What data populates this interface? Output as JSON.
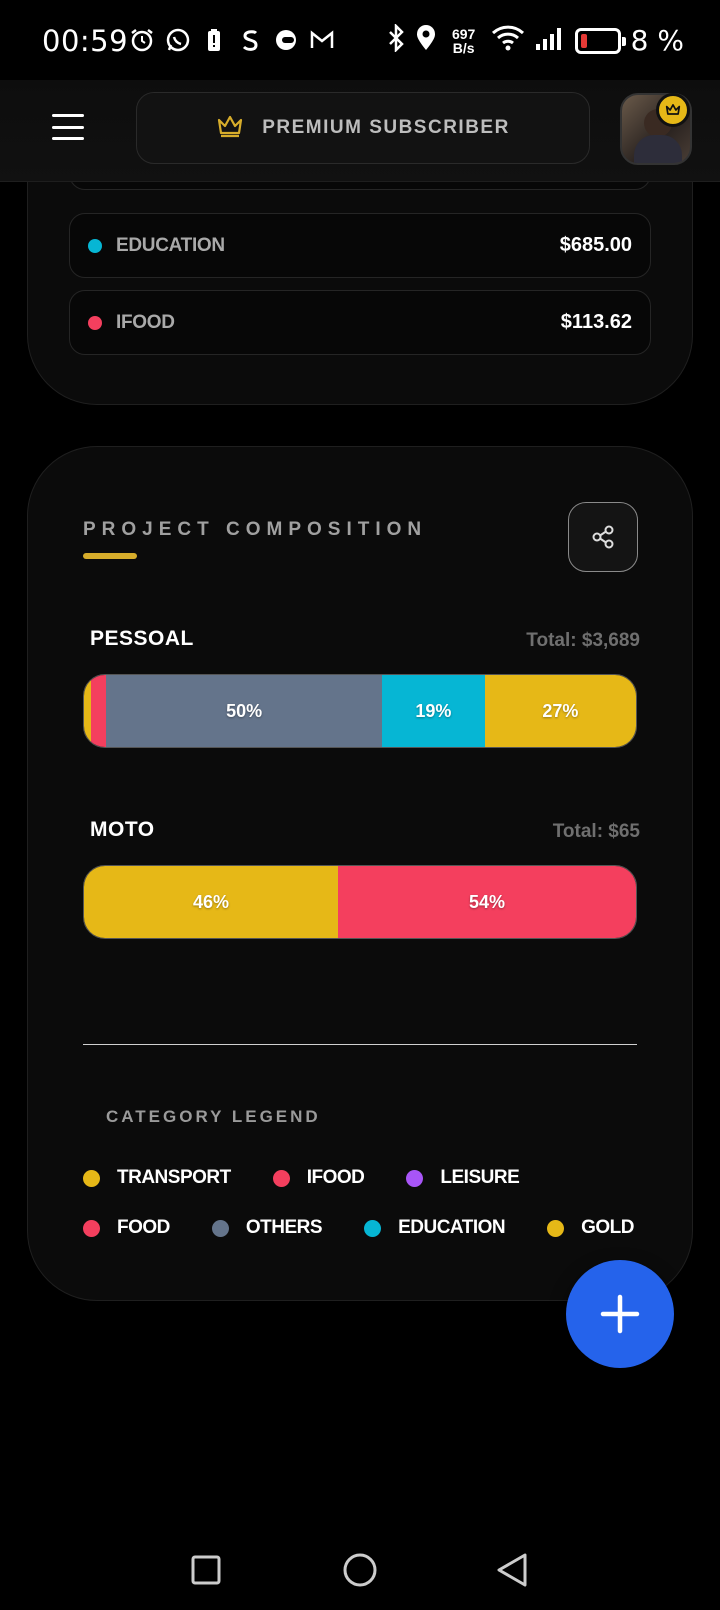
{
  "status_bar": {
    "time": "00:59",
    "net_speed_value": "697",
    "net_speed_unit": "B/s",
    "battery_pct": "8 %",
    "left_icons": [
      "alarm-icon",
      "whatsapp-icon",
      "battery-saver-icon",
      "s-app-icon",
      "cloud-app-icon",
      "gmail-icon"
    ],
    "right_icons": [
      "bluetooth-icon",
      "location-icon",
      "wifi-icon",
      "signal-icon",
      "battery-icon"
    ]
  },
  "header": {
    "menu_icon": "hamburger-icon",
    "premium_label": "PREMIUM SUBSCRIBER",
    "premium_icon": "crown-icon",
    "accent_color": "#d7ad2b"
  },
  "top_rows": [
    {
      "name": "EDUCATION",
      "amount": "$685.00",
      "color": "#06b6d4"
    },
    {
      "name": "IFOOD",
      "amount": "$113.62",
      "color": "#f43f5e"
    }
  ],
  "composition": {
    "title": "PROJECT COMPOSITION",
    "projects": [
      {
        "name": "PESSOAL",
        "total": "Total: $3,689",
        "segments": [
          {
            "label": "",
            "share": 1.2,
            "color": "#e6b817"
          },
          {
            "label": "",
            "share": 2.8,
            "color": "#f43f5e"
          },
          {
            "label": "50%",
            "share": 50,
            "color": "#64748b"
          },
          {
            "label": "19%",
            "share": 18.6,
            "color": "#06b6d4"
          },
          {
            "label": "27%",
            "share": 27.4,
            "color": "#e6b817"
          }
        ]
      },
      {
        "name": "MOTO",
        "total": "Total: $65",
        "segments": [
          {
            "label": "46%",
            "share": 46,
            "color": "#e6b817"
          },
          {
            "label": "54%",
            "share": 54,
            "color": "#f43f5e"
          }
        ]
      }
    ]
  },
  "legend": {
    "title": "CATEGORY LEGEND",
    "row1": [
      {
        "label": "TRANSPORT",
        "color": "#e6b817"
      },
      {
        "label": "IFOOD",
        "color": "#f43f5e"
      },
      {
        "label": "LEISURE",
        "color": "#a855f7"
      }
    ],
    "row2": [
      {
        "label": "FOOD",
        "color": "#f43f5e"
      },
      {
        "label": "OTHERS",
        "color": "#64748b"
      },
      {
        "label": "EDUCATION",
        "color": "#06b6d4"
      },
      {
        "label": "GOLD",
        "color": "#e6b817"
      }
    ]
  },
  "fab": {
    "icon": "plus-icon",
    "color": "#2563eb"
  },
  "nav": {
    "icons": [
      "recents-square-icon",
      "home-circle-icon",
      "back-triangle-icon"
    ]
  }
}
